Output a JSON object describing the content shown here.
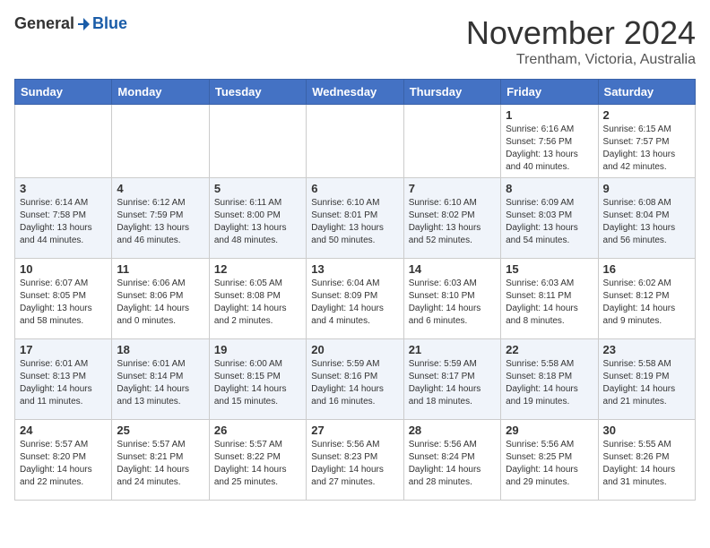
{
  "header": {
    "logo_general": "General",
    "logo_blue": "Blue",
    "month_title": "November 2024",
    "location": "Trentham, Victoria, Australia"
  },
  "calendar": {
    "days_of_week": [
      "Sunday",
      "Monday",
      "Tuesday",
      "Wednesday",
      "Thursday",
      "Friday",
      "Saturday"
    ],
    "weeks": [
      [
        {
          "day": "",
          "info": ""
        },
        {
          "day": "",
          "info": ""
        },
        {
          "day": "",
          "info": ""
        },
        {
          "day": "",
          "info": ""
        },
        {
          "day": "",
          "info": ""
        },
        {
          "day": "1",
          "info": "Sunrise: 6:16 AM\nSunset: 7:56 PM\nDaylight: 13 hours\nand 40 minutes."
        },
        {
          "day": "2",
          "info": "Sunrise: 6:15 AM\nSunset: 7:57 PM\nDaylight: 13 hours\nand 42 minutes."
        }
      ],
      [
        {
          "day": "3",
          "info": "Sunrise: 6:14 AM\nSunset: 7:58 PM\nDaylight: 13 hours\nand 44 minutes."
        },
        {
          "day": "4",
          "info": "Sunrise: 6:12 AM\nSunset: 7:59 PM\nDaylight: 13 hours\nand 46 minutes."
        },
        {
          "day": "5",
          "info": "Sunrise: 6:11 AM\nSunset: 8:00 PM\nDaylight: 13 hours\nand 48 minutes."
        },
        {
          "day": "6",
          "info": "Sunrise: 6:10 AM\nSunset: 8:01 PM\nDaylight: 13 hours\nand 50 minutes."
        },
        {
          "day": "7",
          "info": "Sunrise: 6:10 AM\nSunset: 8:02 PM\nDaylight: 13 hours\nand 52 minutes."
        },
        {
          "day": "8",
          "info": "Sunrise: 6:09 AM\nSunset: 8:03 PM\nDaylight: 13 hours\nand 54 minutes."
        },
        {
          "day": "9",
          "info": "Sunrise: 6:08 AM\nSunset: 8:04 PM\nDaylight: 13 hours\nand 56 minutes."
        }
      ],
      [
        {
          "day": "10",
          "info": "Sunrise: 6:07 AM\nSunset: 8:05 PM\nDaylight: 13 hours\nand 58 minutes."
        },
        {
          "day": "11",
          "info": "Sunrise: 6:06 AM\nSunset: 8:06 PM\nDaylight: 14 hours\nand 0 minutes."
        },
        {
          "day": "12",
          "info": "Sunrise: 6:05 AM\nSunset: 8:08 PM\nDaylight: 14 hours\nand 2 minutes."
        },
        {
          "day": "13",
          "info": "Sunrise: 6:04 AM\nSunset: 8:09 PM\nDaylight: 14 hours\nand 4 minutes."
        },
        {
          "day": "14",
          "info": "Sunrise: 6:03 AM\nSunset: 8:10 PM\nDaylight: 14 hours\nand 6 minutes."
        },
        {
          "day": "15",
          "info": "Sunrise: 6:03 AM\nSunset: 8:11 PM\nDaylight: 14 hours\nand 8 minutes."
        },
        {
          "day": "16",
          "info": "Sunrise: 6:02 AM\nSunset: 8:12 PM\nDaylight: 14 hours\nand 9 minutes."
        }
      ],
      [
        {
          "day": "17",
          "info": "Sunrise: 6:01 AM\nSunset: 8:13 PM\nDaylight: 14 hours\nand 11 minutes."
        },
        {
          "day": "18",
          "info": "Sunrise: 6:01 AM\nSunset: 8:14 PM\nDaylight: 14 hours\nand 13 minutes."
        },
        {
          "day": "19",
          "info": "Sunrise: 6:00 AM\nSunset: 8:15 PM\nDaylight: 14 hours\nand 15 minutes."
        },
        {
          "day": "20",
          "info": "Sunrise: 5:59 AM\nSunset: 8:16 PM\nDaylight: 14 hours\nand 16 minutes."
        },
        {
          "day": "21",
          "info": "Sunrise: 5:59 AM\nSunset: 8:17 PM\nDaylight: 14 hours\nand 18 minutes."
        },
        {
          "day": "22",
          "info": "Sunrise: 5:58 AM\nSunset: 8:18 PM\nDaylight: 14 hours\nand 19 minutes."
        },
        {
          "day": "23",
          "info": "Sunrise: 5:58 AM\nSunset: 8:19 PM\nDaylight: 14 hours\nand 21 minutes."
        }
      ],
      [
        {
          "day": "24",
          "info": "Sunrise: 5:57 AM\nSunset: 8:20 PM\nDaylight: 14 hours\nand 22 minutes."
        },
        {
          "day": "25",
          "info": "Sunrise: 5:57 AM\nSunset: 8:21 PM\nDaylight: 14 hours\nand 24 minutes."
        },
        {
          "day": "26",
          "info": "Sunrise: 5:57 AM\nSunset: 8:22 PM\nDaylight: 14 hours\nand 25 minutes."
        },
        {
          "day": "27",
          "info": "Sunrise: 5:56 AM\nSunset: 8:23 PM\nDaylight: 14 hours\nand 27 minutes."
        },
        {
          "day": "28",
          "info": "Sunrise: 5:56 AM\nSunset: 8:24 PM\nDaylight: 14 hours\nand 28 minutes."
        },
        {
          "day": "29",
          "info": "Sunrise: 5:56 AM\nSunset: 8:25 PM\nDaylight: 14 hours\nand 29 minutes."
        },
        {
          "day": "30",
          "info": "Sunrise: 5:55 AM\nSunset: 8:26 PM\nDaylight: 14 hours\nand 31 minutes."
        }
      ]
    ]
  }
}
